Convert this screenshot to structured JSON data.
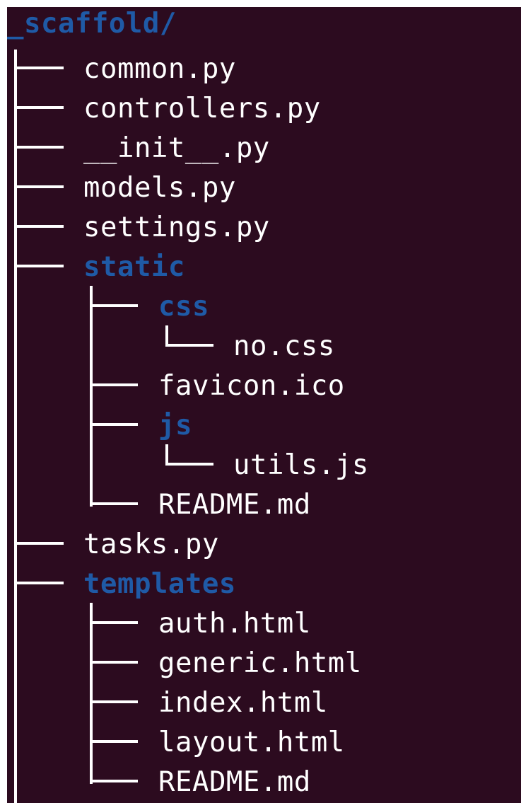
{
  "tree": {
    "root": "_scaffold/",
    "entries": [
      {
        "name": "common.py",
        "type": "file"
      },
      {
        "name": "controllers.py",
        "type": "file"
      },
      {
        "name": "__init__.py",
        "type": "file"
      },
      {
        "name": "models.py",
        "type": "file"
      },
      {
        "name": "settings.py",
        "type": "file"
      },
      {
        "name": "static",
        "type": "dir"
      },
      {
        "name": "css",
        "type": "dir"
      },
      {
        "name": "no.css",
        "type": "file"
      },
      {
        "name": "favicon.ico",
        "type": "file"
      },
      {
        "name": "js",
        "type": "dir"
      },
      {
        "name": "utils.js",
        "type": "file"
      },
      {
        "name": "README.md",
        "type": "file"
      },
      {
        "name": "tasks.py",
        "type": "file"
      },
      {
        "name": "templates",
        "type": "dir"
      },
      {
        "name": "auth.html",
        "type": "file"
      },
      {
        "name": "generic.html",
        "type": "file"
      },
      {
        "name": "index.html",
        "type": "file"
      },
      {
        "name": "layout.html",
        "type": "file"
      },
      {
        "name": "README.md",
        "type": "file"
      }
    ]
  },
  "colors": {
    "background": "#2c0b1f",
    "directory": "#1f5aa6",
    "file": "#ffffff"
  }
}
